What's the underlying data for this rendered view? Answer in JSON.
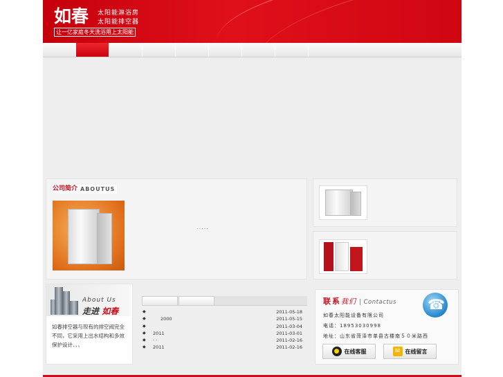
{
  "header": {
    "brand": "如春",
    "subtitle_1": "太阳能淋浴房",
    "subtitle_2": "太阳能排空器",
    "slogan": "让一亿家庭冬天洗浴用上太阳能"
  },
  "nav": {
    "items": 8,
    "active_index": 1,
    "active_color": "#e0101a"
  },
  "about": {
    "title_cn": "公司简介",
    "title_en": "ABOUTUS",
    "more": "....."
  },
  "aboutus_box": {
    "title_en": "About Us",
    "title_cn_1": "走进",
    "title_cn_2": "如春",
    "text": "如春排空器与现有的排空阀完全不同，它采用上出水结构和多效保护设计、、、"
  },
  "news": {
    "rows": [
      {
        "title": "",
        "date": "2011-05-18"
      },
      {
        "title": "2000",
        "date": "2011-05-15"
      },
      {
        "title": "",
        "date": "2011-03-04"
      },
      {
        "title": "2011",
        "date": "2011-03-01"
      },
      {
        "title": "· ·",
        "date": "2011-02-16"
      },
      {
        "title": "2011",
        "date": "2011-02-16"
      }
    ]
  },
  "contact": {
    "title_cn_1": "联系",
    "title_cn_2": "我们",
    "title_en": "Contactus",
    "company": "如春太阳能设备有限公司",
    "phone": "电话：18953030998",
    "address": "地址：山东省菏泽市单县古楼南５０米路西",
    "btn_service": "在线客服",
    "btn_message": "在线留言"
  },
  "colors": {
    "brand_red": "#c8101c",
    "panel_gray": "#eeeeee"
  }
}
